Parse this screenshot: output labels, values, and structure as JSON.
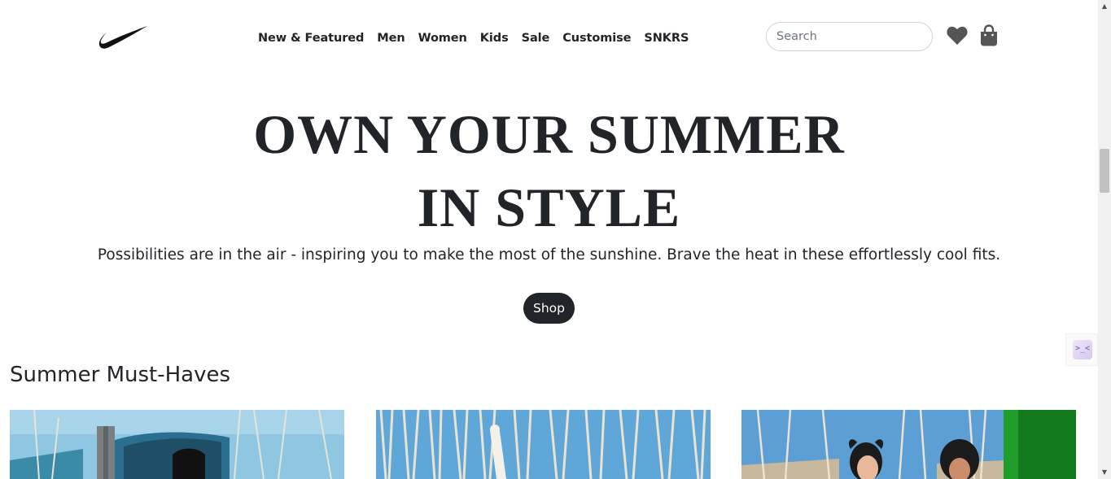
{
  "header": {
    "logo": "nike-swoosh-logo",
    "nav": [
      "New & Featured",
      "Men",
      "Women",
      "Kids",
      "Sale",
      "Customise",
      "SNKRS"
    ],
    "search_placeholder": "Search",
    "wishlist_icon": "heart-icon",
    "cart_icon": "shopping-bag-icon"
  },
  "hero": {
    "title_line1": "OWN YOUR SUMMER",
    "title_line2": "IN STYLE",
    "subtitle": "Possibilities are in the air - inspiring you to make the most of the sunshine. Brave the heat in these effortlessly cool fits.",
    "cta_label": "Shop"
  },
  "section": {
    "title": "Summer Must-Haves"
  },
  "extension_widget": {
    "glyph": ">_<"
  },
  "colors": {
    "text": "#212529",
    "button_bg": "#212529",
    "button_text": "#ffffff"
  }
}
